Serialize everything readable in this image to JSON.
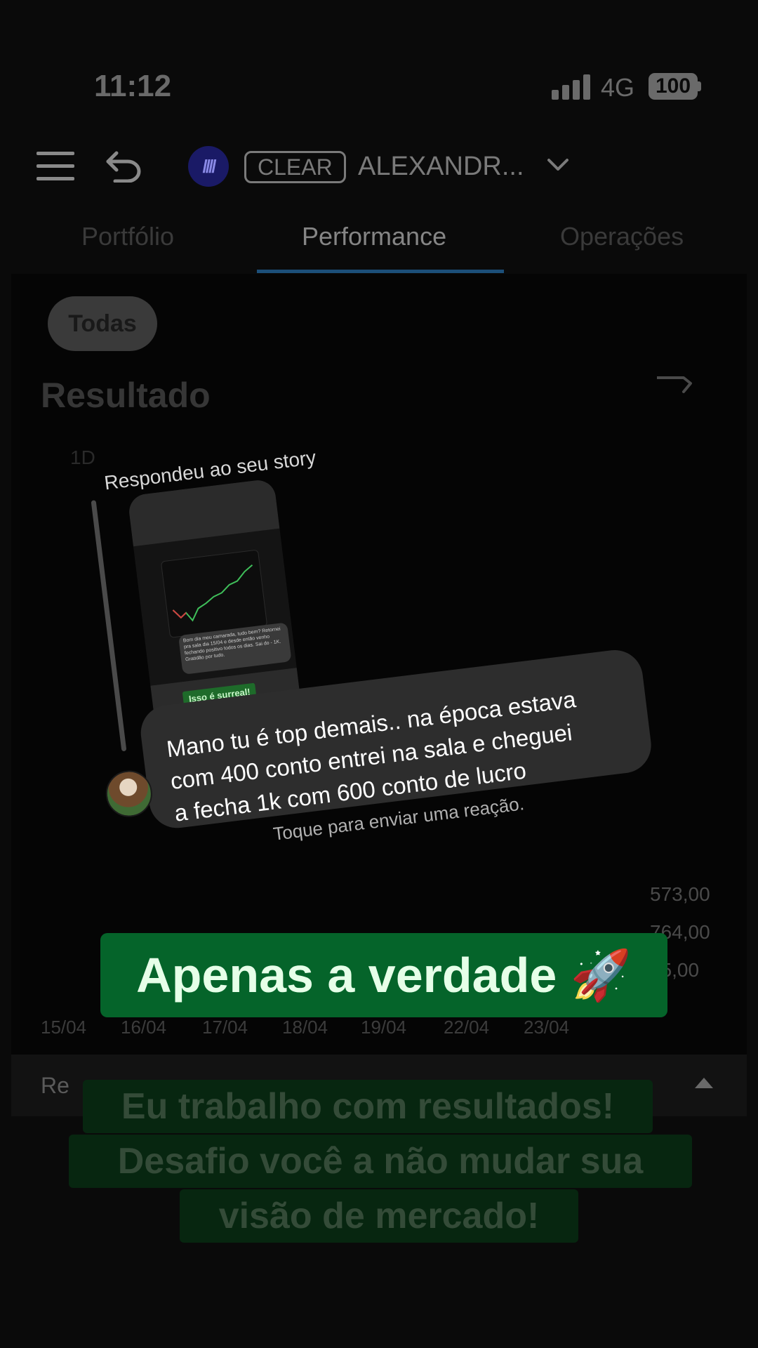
{
  "status": {
    "time": "11:12",
    "network": "4G",
    "battery": "100"
  },
  "header": {
    "broker_logo": "////",
    "broker": "CLEAR",
    "account": "ALEXANDR...",
    "menu_icon": "hamburger-menu-icon",
    "back_icon": "undo-arrow-icon",
    "chevron_icon": "chevron-down-icon"
  },
  "tabs": [
    {
      "label": "Portfólio",
      "active": false
    },
    {
      "label": "Performance",
      "active": true
    },
    {
      "label": "Operações",
      "active": false
    }
  ],
  "filter": {
    "label": "Todas"
  },
  "section": {
    "title": "Resultado",
    "period": "1D"
  },
  "chart": {
    "y_ticks": [
      "573,00",
      "764,00",
      "55,00"
    ],
    "x_ticks": [
      "15/04",
      "16/04",
      "17/04",
      "18/04",
      "19/04",
      "22/04",
      "23/04"
    ]
  },
  "bottom": {
    "label": "Re"
  },
  "dm": {
    "caption": "Respondeu ao seu story",
    "story_preview": {
      "message": "Bom dia meu camarada, tudo bem? Retornei pra sala dia 15/04 e desde então venho fechando positivo todos os dias. Sai do - 1K. Gratidão por tudo.",
      "label": "Isso é surreal!"
    },
    "message_lines": [
      "Mano tu é top demais.. na época estava",
      "com 400 conto entrei na sala e cheguei",
      "a fecha 1k com 600 conto de lucro"
    ],
    "reaction_hint": "Toque para enviar uma reação."
  },
  "captions": {
    "headline": "Apenas a verdade 🚀",
    "lines": [
      "Eu trabalho com resultados!",
      "Desafio você a não mudar sua",
      "visão de mercado!"
    ]
  },
  "colors": {
    "headline_bg": "#05642a",
    "tab_underline": "#1c4f79",
    "caption_bg": "#072610"
  }
}
